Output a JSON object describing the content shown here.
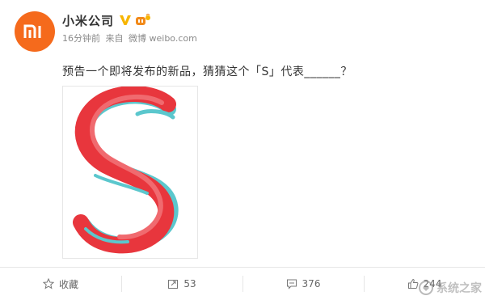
{
  "post": {
    "author": "小米公司",
    "time": "16分钟前",
    "source_prefix": "来自",
    "source": "微博 weibo.com",
    "text": "预告一个即将发布的新品，猜猜这个「S」代表______？"
  },
  "avatar": {
    "logo": "mi-logo-icon",
    "color": "#f56a1c"
  },
  "actions": {
    "favorite_label": "收藏",
    "repost_count": "53",
    "comment_count": "376",
    "like_count": "244"
  },
  "watermark": {
    "text": "系统之家"
  },
  "colors": {
    "accent_verified": "#f7b500",
    "s_red": "#e8363d",
    "s_teal": "#5bc7cd",
    "text": "#333333",
    "meta": "#8a8a8a"
  }
}
